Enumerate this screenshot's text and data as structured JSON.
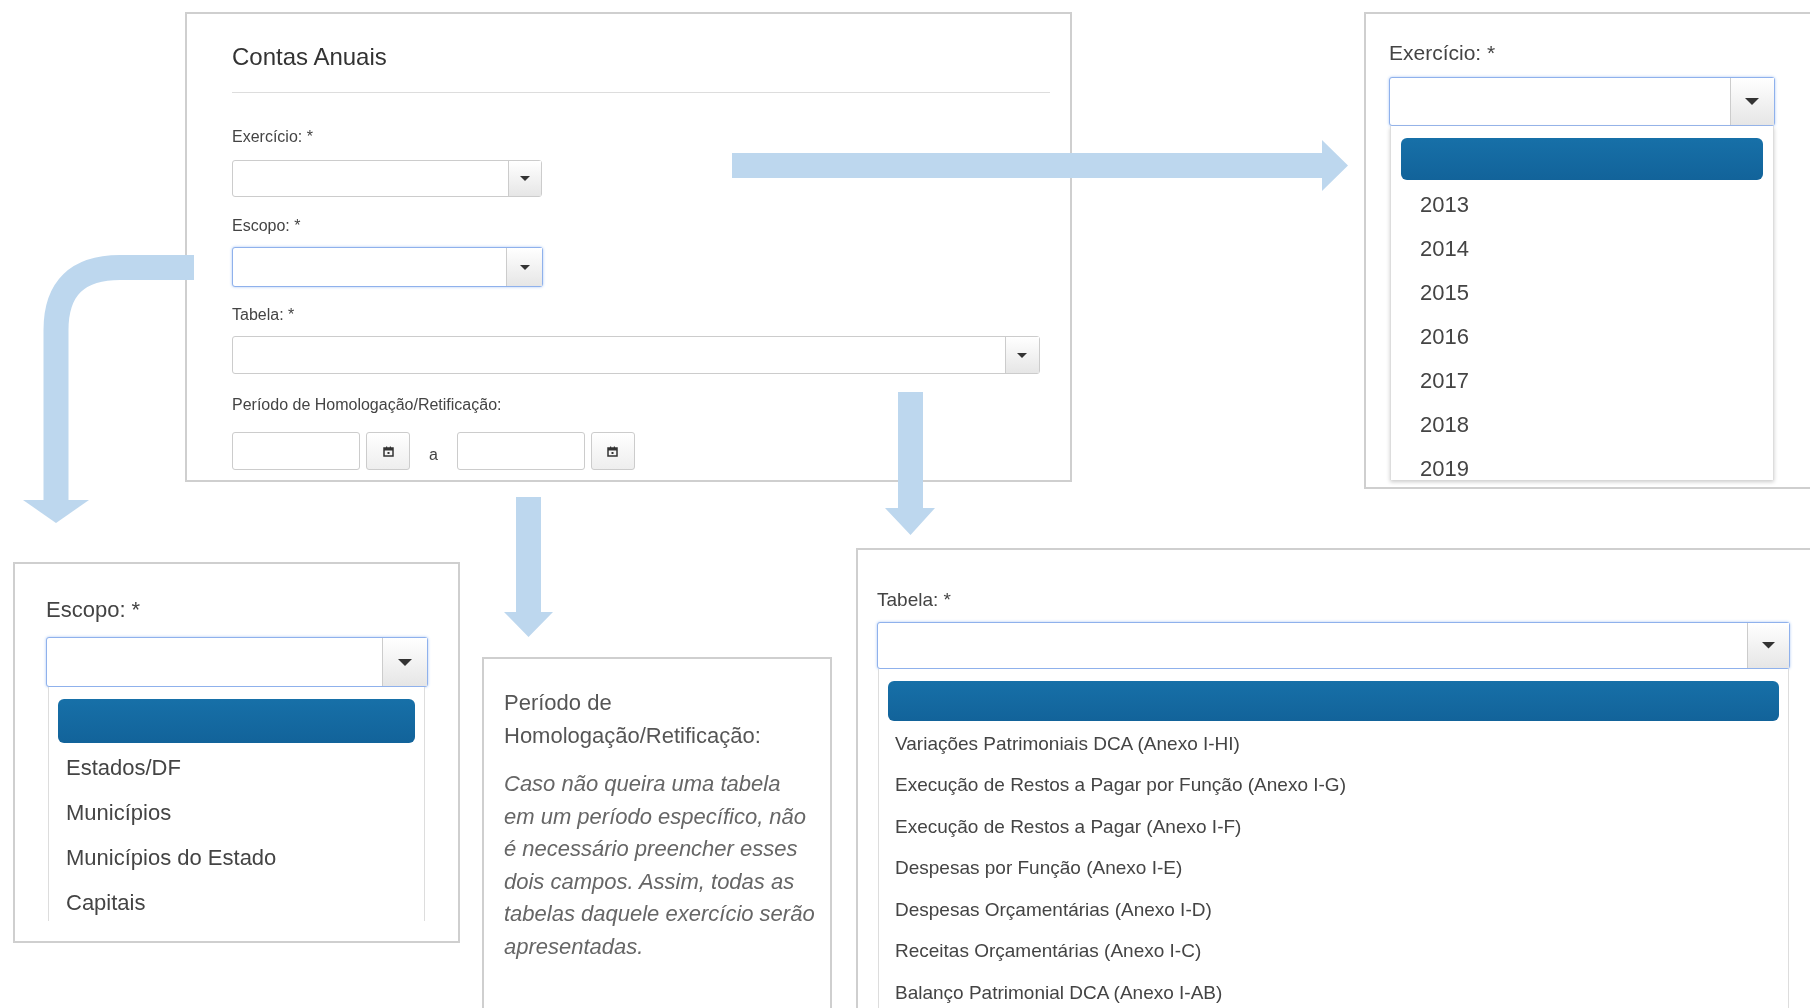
{
  "main_form": {
    "title": "Contas Anuais",
    "fields": [
      {
        "label": "Exercício: *",
        "focused": false
      },
      {
        "label": "Escopo: *",
        "focused": true
      },
      {
        "label": "Tabela: *",
        "focused": false
      }
    ],
    "period": {
      "label": "Período de Homologação/Retificação:",
      "separator": "a"
    }
  },
  "exercicio_dropdown": {
    "label": "Exercício: *",
    "focused": true,
    "options": [
      {
        "selected": true
      },
      {
        "label": "2013",
        "selected": false
      },
      {
        "label": "2014",
        "selected": false
      },
      {
        "label": "2015",
        "selected": false
      },
      {
        "label": "2016",
        "selected": false
      },
      {
        "label": "2017",
        "selected": false
      },
      {
        "label": "2018",
        "selected": false
      },
      {
        "label": "2019",
        "selected": false
      }
    ]
  },
  "escopo_dropdown": {
    "label": "Escopo: *",
    "focused": true,
    "options": [
      {
        "selected": true
      },
      {
        "label": "Estados/DF",
        "selected": false
      },
      {
        "label": "Municípios",
        "selected": false
      },
      {
        "label": "Municípios do Estado",
        "selected": false
      },
      {
        "label": "Capitais",
        "selected": false
      }
    ]
  },
  "period_note": {
    "heading": "Período de Homologação/Retificação:",
    "text": "Caso não queira uma tabela em um período específico, não é necessário preencher esses dois campos. Assim, todas as tabelas daquele exercício serão apresentadas."
  },
  "tabela_dropdown": {
    "label": "Tabela: *",
    "focused": true,
    "options": [
      {
        "selected": true
      },
      {
        "label": "Variações Patrimoniais DCA (Anexo I-HI)",
        "selected": false
      },
      {
        "label": "Execução de Restos a Pagar por Função (Anexo I-G)",
        "selected": false
      },
      {
        "label": "Execução de Restos a Pagar (Anexo I-F)",
        "selected": false
      },
      {
        "label": "Despesas por Função (Anexo I-E)",
        "selected": false
      },
      {
        "label": "Despesas Orçamentárias (Anexo I-D)",
        "selected": false
      },
      {
        "label": "Receitas Orçamentárias (Anexo I-C)",
        "selected": false
      },
      {
        "label": "Balanço Patrimonial DCA (Anexo I-AB)",
        "selected": false
      }
    ]
  }
}
